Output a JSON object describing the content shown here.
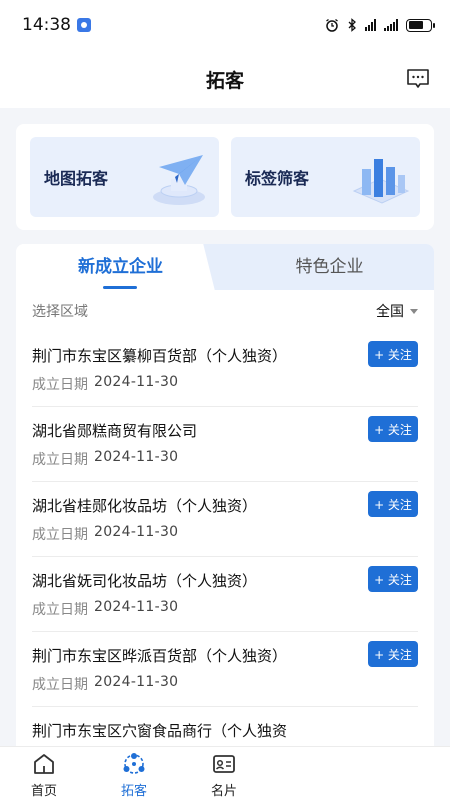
{
  "status_bar": {
    "time": "14:38",
    "icons": [
      "alarm-icon",
      "bluetooth-icon",
      "signal-icon",
      "signal-icon",
      "battery-icon"
    ]
  },
  "header": {
    "title": "拓客",
    "message_icon": "message-icon"
  },
  "quick_actions": [
    {
      "label": "地图拓客",
      "icon": "paper-plane-icon"
    },
    {
      "label": "标签筛客",
      "icon": "bar-chart-icon"
    }
  ],
  "tabs": [
    {
      "label": "新成立企业",
      "active": true
    },
    {
      "label": "特色企业",
      "active": false
    }
  ],
  "region_filter": {
    "label": "选择区域",
    "value": "全国"
  },
  "companies": [
    {
      "name": "荆门市东宝区纂柳百货部（个人独资）",
      "date_label": "成立日期",
      "date": "2024-11-30",
      "follow": "+ 关注"
    },
    {
      "name": "湖北省郧糕商贸有限公司",
      "date_label": "成立日期",
      "date": "2024-11-30",
      "follow": "+ 关注"
    },
    {
      "name": "湖北省桂郧化妆品坊（个人独资）",
      "date_label": "成立日期",
      "date": "2024-11-30",
      "follow": "+ 关注"
    },
    {
      "name": "湖北省妩司化妆品坊（个人独资）",
      "date_label": "成立日期",
      "date": "2024-11-30",
      "follow": "+ 关注"
    },
    {
      "name": "荆门市东宝区晔派百货部（个人独资）",
      "date_label": "成立日期",
      "date": "2024-11-30",
      "follow": "+ 关注"
    },
    {
      "name": "荆门市东宝区穴窗食品商行（个人独资",
      "date_label": "",
      "date": "",
      "follow": ""
    }
  ],
  "bottom_nav": [
    {
      "label": "首页",
      "icon": "home-icon",
      "active": false
    },
    {
      "label": "拓客",
      "icon": "network-icon",
      "active": true
    },
    {
      "label": "名片",
      "icon": "id-card-icon",
      "active": false
    }
  ],
  "colors": {
    "accent": "#1f6fd6",
    "background": "#f3f5f9",
    "card_tint": "#e9f0fc"
  }
}
